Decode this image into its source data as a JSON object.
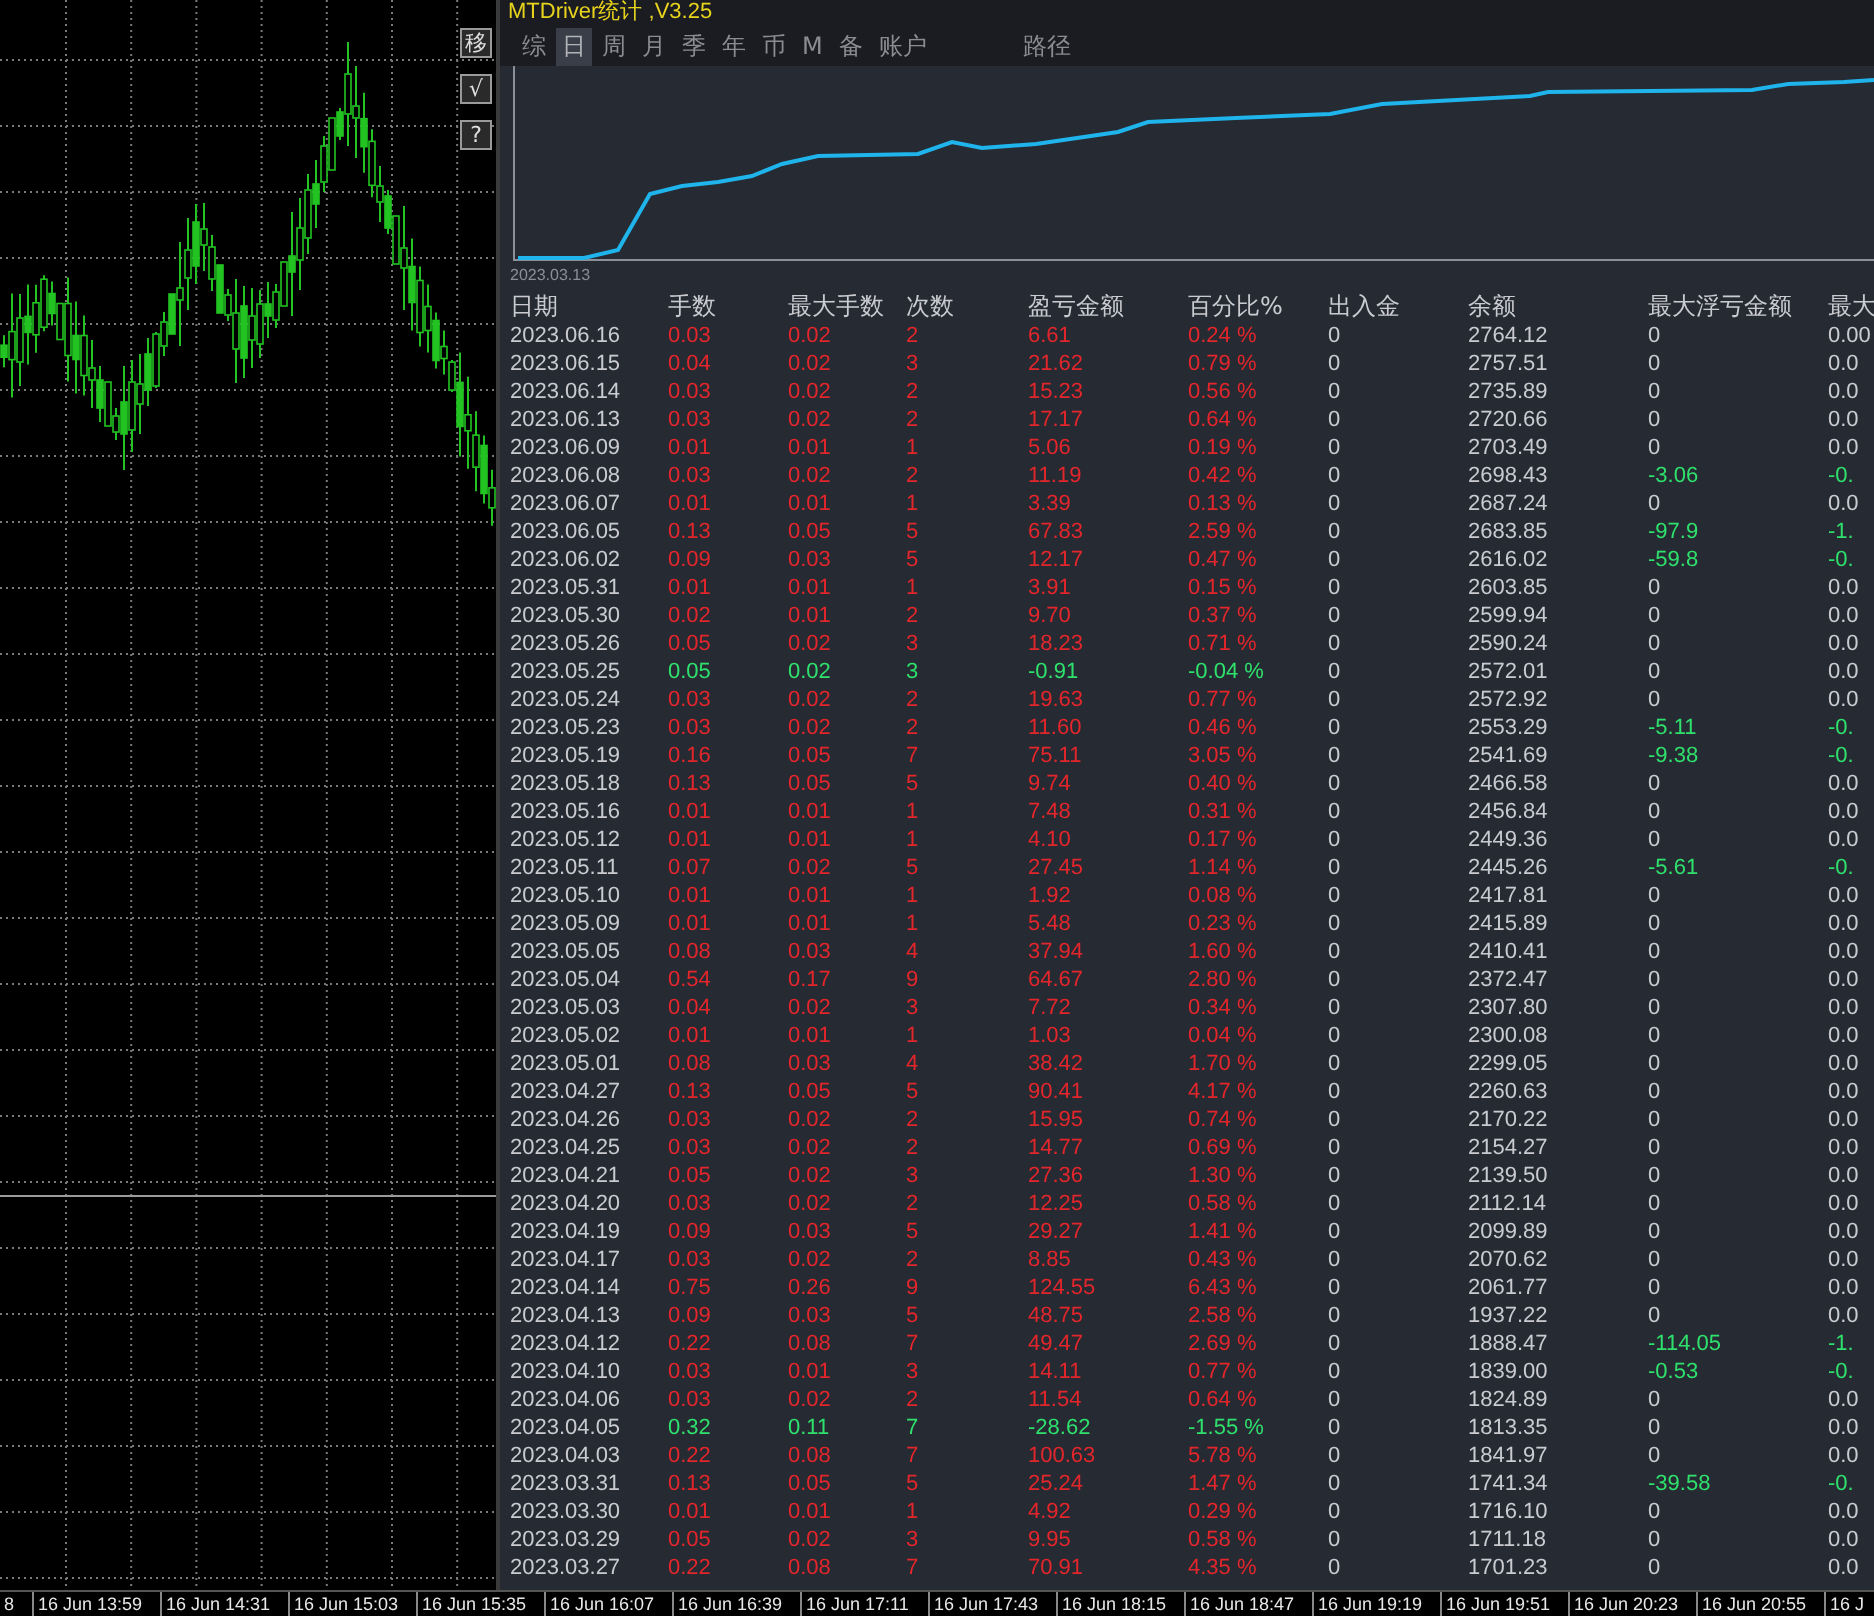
{
  "chart_panel": {
    "buttons": [
      "移",
      "√",
      "?"
    ]
  },
  "stats_window": {
    "title": "MTDriver统计 ,V3.25",
    "tabs": [
      {
        "label": "综",
        "selected": false
      },
      {
        "label": "日",
        "selected": true
      },
      {
        "label": "周",
        "selected": false
      },
      {
        "label": "月",
        "selected": false
      },
      {
        "label": "季",
        "selected": false
      },
      {
        "label": "年",
        "selected": false
      },
      {
        "label": "币",
        "selected": false
      },
      {
        "label": "M",
        "selected": false
      },
      {
        "label": "备",
        "selected": false
      },
      {
        "label": "账户",
        "selected": false
      },
      {
        "label": "路径",
        "selected": false
      }
    ],
    "equity_chart": {
      "start_label": "2023.03.13"
    },
    "table": {
      "columns": [
        "日期",
        "手数",
        "最大手数",
        "次数",
        "盈亏金额",
        "百分比%",
        "出入金",
        "余额",
        "最大浮亏金额",
        "最大"
      ],
      "rows": [
        {
          "cells": [
            "2023.06.16",
            "0.03",
            "0.02",
            "2",
            "6.61",
            "0.24 %",
            "0",
            "2764.12",
            "0",
            "0.00"
          ],
          "loss": false,
          "drawdown": false
        },
        {
          "cells": [
            "2023.06.15",
            "0.04",
            "0.02",
            "3",
            "21.62",
            "0.79 %",
            "0",
            "2757.51",
            "0",
            "0.0"
          ],
          "loss": false,
          "drawdown": false
        },
        {
          "cells": [
            "2023.06.14",
            "0.03",
            "0.02",
            "2",
            "15.23",
            "0.56 %",
            "0",
            "2735.89",
            "0",
            "0.0"
          ],
          "loss": false,
          "drawdown": false
        },
        {
          "cells": [
            "2023.06.13",
            "0.03",
            "0.02",
            "2",
            "17.17",
            "0.64 %",
            "0",
            "2720.66",
            "0",
            "0.0"
          ],
          "loss": false,
          "drawdown": false
        },
        {
          "cells": [
            "2023.06.09",
            "0.01",
            "0.01",
            "1",
            "5.06",
            "0.19 %",
            "0",
            "2703.49",
            "0",
            "0.0"
          ],
          "loss": false,
          "drawdown": false
        },
        {
          "cells": [
            "2023.06.08",
            "0.03",
            "0.02",
            "2",
            "11.19",
            "0.42 %",
            "0",
            "2698.43",
            "-3.06",
            "-0."
          ],
          "loss": false,
          "drawdown": true
        },
        {
          "cells": [
            "2023.06.07",
            "0.01",
            "0.01",
            "1",
            "3.39",
            "0.13 %",
            "0",
            "2687.24",
            "0",
            "0.0"
          ],
          "loss": false,
          "drawdown": false
        },
        {
          "cells": [
            "2023.06.05",
            "0.13",
            "0.05",
            "5",
            "67.83",
            "2.59 %",
            "0",
            "2683.85",
            "-97.9",
            "-1."
          ],
          "loss": false,
          "drawdown": true
        },
        {
          "cells": [
            "2023.06.02",
            "0.09",
            "0.03",
            "5",
            "12.17",
            "0.47 %",
            "0",
            "2616.02",
            "-59.8",
            "-0."
          ],
          "loss": false,
          "drawdown": true
        },
        {
          "cells": [
            "2023.05.31",
            "0.01",
            "0.01",
            "1",
            "3.91",
            "0.15 %",
            "0",
            "2603.85",
            "0",
            "0.0"
          ],
          "loss": false,
          "drawdown": false
        },
        {
          "cells": [
            "2023.05.30",
            "0.02",
            "0.01",
            "2",
            "9.70",
            "0.37 %",
            "0",
            "2599.94",
            "0",
            "0.0"
          ],
          "loss": false,
          "drawdown": false
        },
        {
          "cells": [
            "2023.05.26",
            "0.05",
            "0.02",
            "3",
            "18.23",
            "0.71 %",
            "0",
            "2590.24",
            "0",
            "0.0"
          ],
          "loss": false,
          "drawdown": false
        },
        {
          "cells": [
            "2023.05.25",
            "0.05",
            "0.02",
            "3",
            "-0.91",
            "-0.04 %",
            "0",
            "2572.01",
            "0",
            "0.0"
          ],
          "loss": true,
          "drawdown": false
        },
        {
          "cells": [
            "2023.05.24",
            "0.03",
            "0.02",
            "2",
            "19.63",
            "0.77 %",
            "0",
            "2572.92",
            "0",
            "0.0"
          ],
          "loss": false,
          "drawdown": false
        },
        {
          "cells": [
            "2023.05.23",
            "0.03",
            "0.02",
            "2",
            "11.60",
            "0.46 %",
            "0",
            "2553.29",
            "-5.11",
            "-0."
          ],
          "loss": false,
          "drawdown": true
        },
        {
          "cells": [
            "2023.05.19",
            "0.16",
            "0.05",
            "7",
            "75.11",
            "3.05 %",
            "0",
            "2541.69",
            "-9.38",
            "-0."
          ],
          "loss": false,
          "drawdown": true
        },
        {
          "cells": [
            "2023.05.18",
            "0.13",
            "0.05",
            "5",
            "9.74",
            "0.40 %",
            "0",
            "2466.58",
            "0",
            "0.0"
          ],
          "loss": false,
          "drawdown": false
        },
        {
          "cells": [
            "2023.05.16",
            "0.01",
            "0.01",
            "1",
            "7.48",
            "0.31 %",
            "0",
            "2456.84",
            "0",
            "0.0"
          ],
          "loss": false,
          "drawdown": false
        },
        {
          "cells": [
            "2023.05.12",
            "0.01",
            "0.01",
            "1",
            "4.10",
            "0.17 %",
            "0",
            "2449.36",
            "0",
            "0.0"
          ],
          "loss": false,
          "drawdown": false
        },
        {
          "cells": [
            "2023.05.11",
            "0.07",
            "0.02",
            "5",
            "27.45",
            "1.14 %",
            "0",
            "2445.26",
            "-5.61",
            "-0."
          ],
          "loss": false,
          "drawdown": true
        },
        {
          "cells": [
            "2023.05.10",
            "0.01",
            "0.01",
            "1",
            "1.92",
            "0.08 %",
            "0",
            "2417.81",
            "0",
            "0.0"
          ],
          "loss": false,
          "drawdown": false
        },
        {
          "cells": [
            "2023.05.09",
            "0.01",
            "0.01",
            "1",
            "5.48",
            "0.23 %",
            "0",
            "2415.89",
            "0",
            "0.0"
          ],
          "loss": false,
          "drawdown": false
        },
        {
          "cells": [
            "2023.05.05",
            "0.08",
            "0.03",
            "4",
            "37.94",
            "1.60 %",
            "0",
            "2410.41",
            "0",
            "0.0"
          ],
          "loss": false,
          "drawdown": false
        },
        {
          "cells": [
            "2023.05.04",
            "0.54",
            "0.17",
            "9",
            "64.67",
            "2.80 %",
            "0",
            "2372.47",
            "0",
            "0.0"
          ],
          "loss": false,
          "drawdown": false
        },
        {
          "cells": [
            "2023.05.03",
            "0.04",
            "0.02",
            "3",
            "7.72",
            "0.34 %",
            "0",
            "2307.80",
            "0",
            "0.0"
          ],
          "loss": false,
          "drawdown": false
        },
        {
          "cells": [
            "2023.05.02",
            "0.01",
            "0.01",
            "1",
            "1.03",
            "0.04 %",
            "0",
            "2300.08",
            "0",
            "0.0"
          ],
          "loss": false,
          "drawdown": false
        },
        {
          "cells": [
            "2023.05.01",
            "0.08",
            "0.03",
            "4",
            "38.42",
            "1.70 %",
            "0",
            "2299.05",
            "0",
            "0.0"
          ],
          "loss": false,
          "drawdown": false
        },
        {
          "cells": [
            "2023.04.27",
            "0.13",
            "0.05",
            "5",
            "90.41",
            "4.17 %",
            "0",
            "2260.63",
            "0",
            "0.0"
          ],
          "loss": false,
          "drawdown": false
        },
        {
          "cells": [
            "2023.04.26",
            "0.03",
            "0.02",
            "2",
            "15.95",
            "0.74 %",
            "0",
            "2170.22",
            "0",
            "0.0"
          ],
          "loss": false,
          "drawdown": false
        },
        {
          "cells": [
            "2023.04.25",
            "0.03",
            "0.02",
            "2",
            "14.77",
            "0.69 %",
            "0",
            "2154.27",
            "0",
            "0.0"
          ],
          "loss": false,
          "drawdown": false
        },
        {
          "cells": [
            "2023.04.21",
            "0.05",
            "0.02",
            "3",
            "27.36",
            "1.30 %",
            "0",
            "2139.50",
            "0",
            "0.0"
          ],
          "loss": false,
          "drawdown": false
        },
        {
          "cells": [
            "2023.04.20",
            "0.03",
            "0.02",
            "2",
            "12.25",
            "0.58 %",
            "0",
            "2112.14",
            "0",
            "0.0"
          ],
          "loss": false,
          "drawdown": false
        },
        {
          "cells": [
            "2023.04.19",
            "0.09",
            "0.03",
            "5",
            "29.27",
            "1.41 %",
            "0",
            "2099.89",
            "0",
            "0.0"
          ],
          "loss": false,
          "drawdown": false
        },
        {
          "cells": [
            "2023.04.17",
            "0.03",
            "0.02",
            "2",
            "8.85",
            "0.43 %",
            "0",
            "2070.62",
            "0",
            "0.0"
          ],
          "loss": false,
          "drawdown": false
        },
        {
          "cells": [
            "2023.04.14",
            "0.75",
            "0.26",
            "9",
            "124.55",
            "6.43 %",
            "0",
            "2061.77",
            "0",
            "0.0"
          ],
          "loss": false,
          "drawdown": false
        },
        {
          "cells": [
            "2023.04.13",
            "0.09",
            "0.03",
            "5",
            "48.75",
            "2.58 %",
            "0",
            "1937.22",
            "0",
            "0.0"
          ],
          "loss": false,
          "drawdown": false
        },
        {
          "cells": [
            "2023.04.12",
            "0.22",
            "0.08",
            "7",
            "49.47",
            "2.69 %",
            "0",
            "1888.47",
            "-114.05",
            "-1."
          ],
          "loss": false,
          "drawdown": true
        },
        {
          "cells": [
            "2023.04.10",
            "0.03",
            "0.01",
            "3",
            "14.11",
            "0.77 %",
            "0",
            "1839.00",
            "-0.53",
            "-0."
          ],
          "loss": false,
          "drawdown": true
        },
        {
          "cells": [
            "2023.04.06",
            "0.03",
            "0.02",
            "2",
            "11.54",
            "0.64 %",
            "0",
            "1824.89",
            "0",
            "0.0"
          ],
          "loss": false,
          "drawdown": false
        },
        {
          "cells": [
            "2023.04.05",
            "0.32",
            "0.11",
            "7",
            "-28.62",
            "-1.55 %",
            "0",
            "1813.35",
            "0",
            "0.0"
          ],
          "loss": true,
          "drawdown": false
        },
        {
          "cells": [
            "2023.04.03",
            "0.22",
            "0.08",
            "7",
            "100.63",
            "5.78 %",
            "0",
            "1841.97",
            "0",
            "0.0"
          ],
          "loss": false,
          "drawdown": false
        },
        {
          "cells": [
            "2023.03.31",
            "0.13",
            "0.05",
            "5",
            "25.24",
            "1.47 %",
            "0",
            "1741.34",
            "-39.58",
            "-0."
          ],
          "loss": false,
          "drawdown": true
        },
        {
          "cells": [
            "2023.03.30",
            "0.01",
            "0.01",
            "1",
            "4.92",
            "0.29 %",
            "0",
            "1716.10",
            "0",
            "0.0"
          ],
          "loss": false,
          "drawdown": false
        },
        {
          "cells": [
            "2023.03.29",
            "0.05",
            "0.02",
            "3",
            "9.95",
            "0.58 %",
            "0",
            "1711.18",
            "0",
            "0.0"
          ],
          "loss": false,
          "drawdown": false
        },
        {
          "cells": [
            "2023.03.27",
            "0.22",
            "0.08",
            "7",
            "70.91",
            "4.35 %",
            "0",
            "1701.23",
            "0",
            "0.0"
          ],
          "loss": false,
          "drawdown": false
        }
      ]
    }
  },
  "time_axis": {
    "labels": [
      "8",
      "16 Jun 13:59",
      "16 Jun 14:31",
      "16 Jun 15:03",
      "16 Jun 15:35",
      "16 Jun 16:07",
      "16 Jun 16:39",
      "16 Jun 17:11",
      "16 Jun 17:43",
      "16 Jun 18:15",
      "16 Jun 18:47",
      "16 Jun 19:19",
      "16 Jun 19:51",
      "16 Jun 20:23",
      "16 Jun 20:55",
      "16 J"
    ]
  }
}
